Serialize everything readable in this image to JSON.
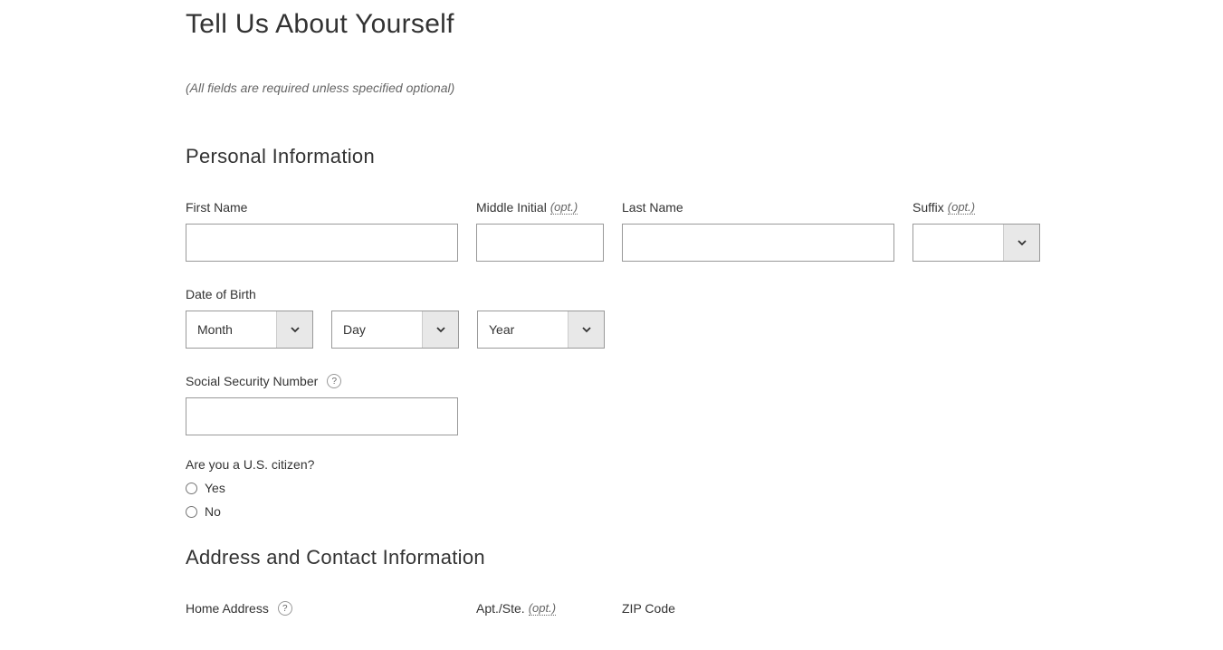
{
  "page": {
    "title": "Tell Us About Yourself",
    "required_note": "(All fields are required unless specified optional)"
  },
  "personal": {
    "heading": "Personal Information",
    "first_name_label": "First Name",
    "middle_initial_label": "Middle Initial",
    "last_name_label": "Last Name",
    "suffix_label": "Suffix",
    "opt_text": "(opt.)",
    "dob_label": "Date of Birth",
    "month_placeholder": "Month",
    "day_placeholder": "Day",
    "year_placeholder": "Year",
    "ssn_label": "Social Security Number",
    "citizen_question": "Are you a U.S. citizen?",
    "yes_label": "Yes",
    "no_label": "No"
  },
  "address": {
    "heading": "Address and Contact Information",
    "home_address_label": "Home Address",
    "apt_label": "Apt./Ste.",
    "zip_label": "ZIP Code"
  }
}
